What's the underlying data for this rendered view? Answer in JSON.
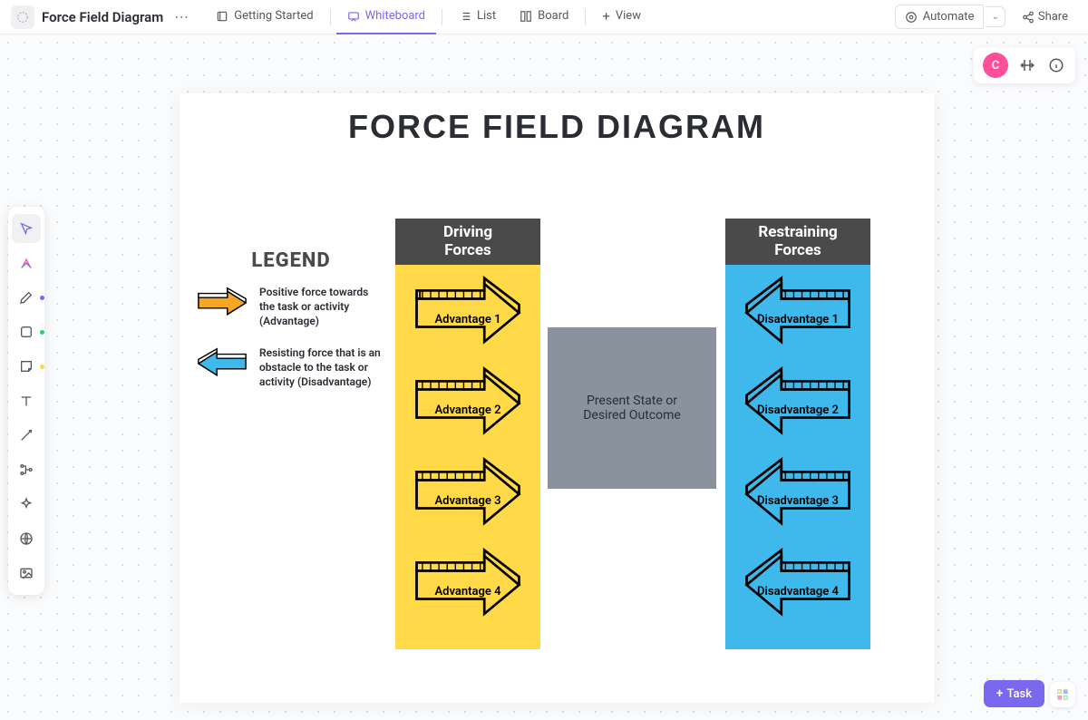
{
  "header": {
    "title": "Force Field Diagram",
    "tabs": [
      {
        "label": "Getting Started"
      },
      {
        "label": "Whiteboard"
      },
      {
        "label": "List"
      },
      {
        "label": "Board"
      },
      {
        "label": "View"
      }
    ],
    "automate": "Automate",
    "share": "Share"
  },
  "avatar": "C",
  "diagram": {
    "title": "FORCE FIELD  DIAGRAM",
    "driving_header": "Driving\nForces",
    "restraining_header": "Restraining\nForces",
    "center": "Present State or Desired Outcome",
    "advantages": [
      "Advantage 1",
      "Advantage 2",
      "Advantage 3",
      "Advantage 4"
    ],
    "disadvantages": [
      "Disadvantage 1",
      "Disadvantage 2",
      "Disadvantage 3",
      "Disadvantage 4"
    ]
  },
  "legend": {
    "title": "LEGEND",
    "positive": "Positive force towards the task or activity (Advantage)",
    "negative": "Resisting force that is an obstacle to the task or activity (Disadvantage)"
  },
  "task_btn": "Task"
}
